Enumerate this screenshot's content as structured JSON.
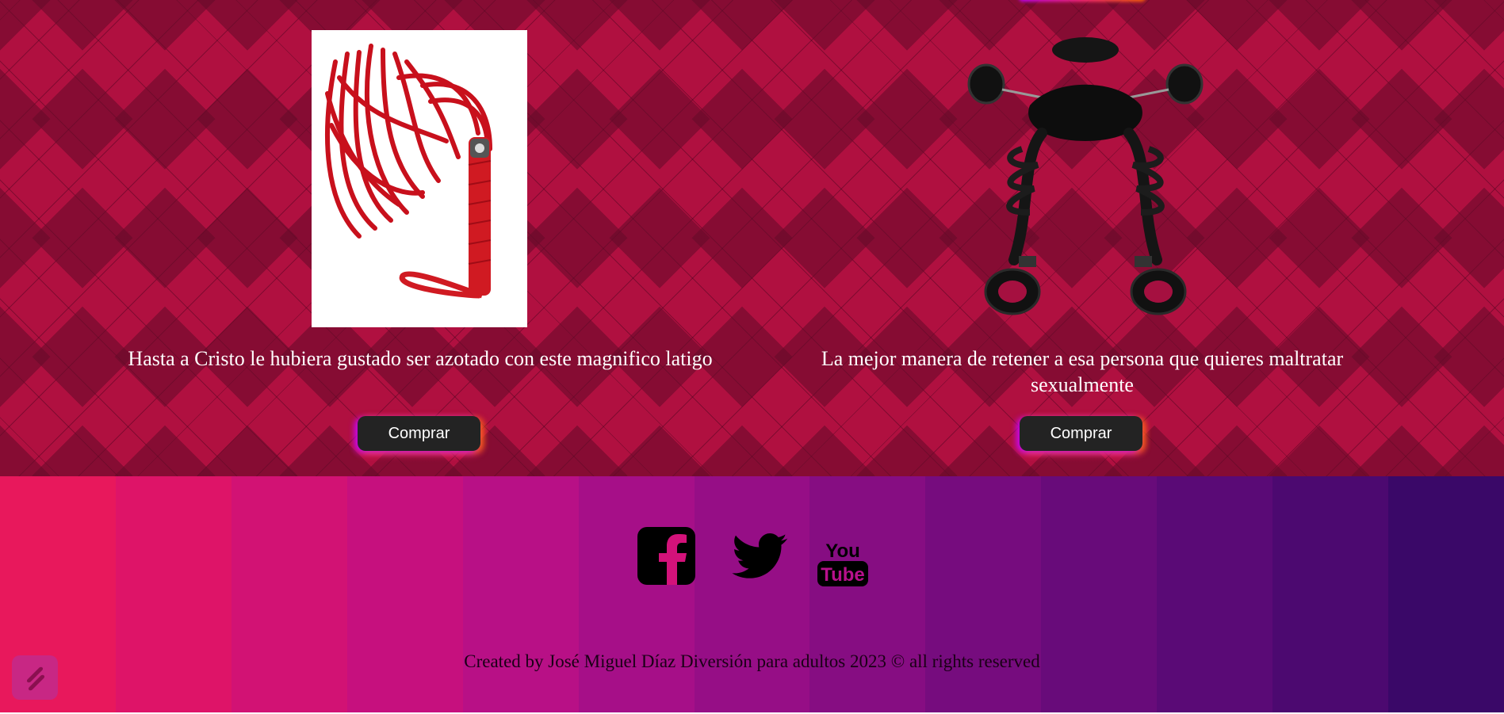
{
  "products": [
    {
      "description": "Hasta a Cristo le hubiera gustado ser azotado con este magnifico latigo",
      "button_label": "Comprar",
      "image": "red-leather-flogger"
    },
    {
      "description": "La mejor manera de retener a esa persona que quieres maltratar sexualmente",
      "button_label": "Comprar",
      "image": "black-bed-restraint-kit"
    }
  ],
  "footer": {
    "social": [
      "facebook-icon",
      "twitter-icon",
      "youtube-icon"
    ],
    "youtube_text_top": "You",
    "youtube_text_bottom": "Tube",
    "copyright": "Created by José Miguel Díaz Diversión para adultos 2023 © all rights reserved"
  },
  "colors": {
    "product_bg": "#b01040",
    "button_bg": "#232323",
    "footer_gradient_start": "#e8185c",
    "footer_gradient_end": "#3a0868"
  }
}
